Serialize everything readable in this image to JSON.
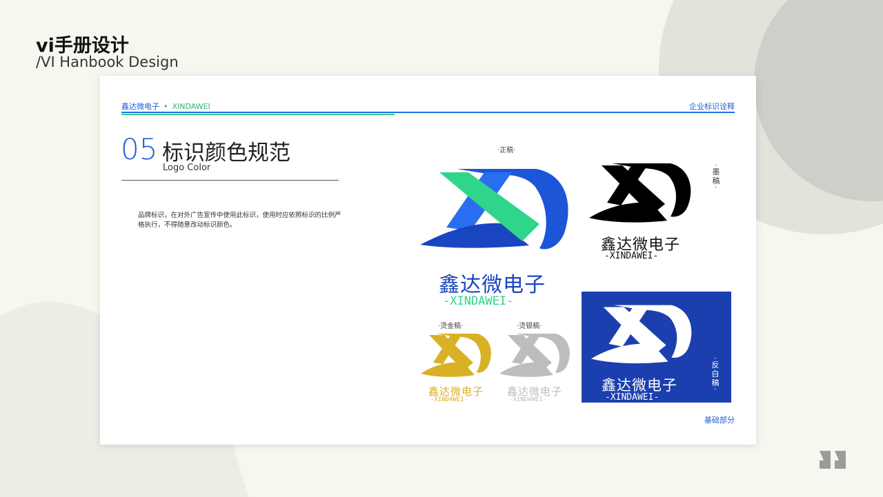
{
  "page": {
    "title": "vi手册设计",
    "subtitle": "/VI Hanbook Design"
  },
  "card": {
    "brand_cn": "鑫达微电子",
    "brand_en": "XINDAWEI",
    "section_label": "企业标识诠释",
    "section_number": "05",
    "section_title": "标识颜色规范",
    "section_subtitle": "Logo Color",
    "description": "品牌标识，在对外广告宣传中使用此标识，使用时应依照标识的比例严格执行，不得随意改动标识颜色。",
    "footer": "基础部分"
  },
  "logos": {
    "primary": {
      "label": "·正稿·",
      "cn": "鑫达微电子",
      "en": "-XINDAWEI-"
    },
    "black": {
      "label": "·墨稿·",
      "cn": "鑫达微电子",
      "en": "-XINDAWEI-"
    },
    "gold": {
      "label": "·烫金稿·",
      "cn": "鑫达微电子",
      "en": "-XINDAWEI-"
    },
    "silver": {
      "label": "·烫银稿·",
      "cn": "鑫达微电子",
      "en": "-XINDAWEI-"
    },
    "reverse": {
      "label": "·反白稿·",
      "cn": "鑫达微电子",
      "en": "-XINDAWEI-"
    }
  },
  "colors": {
    "brand_blue": "#1c3fb0",
    "brand_green": "#2fd58a",
    "gold": "#d8b126",
    "silver": "#bdbdbd",
    "black": "#000000"
  }
}
